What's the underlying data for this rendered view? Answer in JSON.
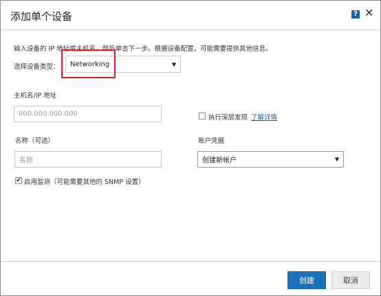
{
  "dialog": {
    "title": "添加单个设备",
    "help_icon": "?",
    "close_icon": "✕"
  },
  "intro": "输入设备的 IP 地址或主机名，然后单击下一步。根据设备配置，可能需要提供其他信息。",
  "device_type": {
    "label": "选择设备类型：",
    "value": "Networking"
  },
  "hostname": {
    "label": "主机名/IP 地址",
    "placeholder": "000.000.000.000"
  },
  "deep_discovery": {
    "label": "执行深层发现",
    "link": "了解详情",
    "checked": false
  },
  "name_field": {
    "label": "名称（可选）",
    "placeholder": "名称"
  },
  "credentials": {
    "label": "账户凭据",
    "value": "创建新帐户"
  },
  "monitoring": {
    "label": "启用监测（可能需要其他的 SNMP 设置）",
    "checked": true,
    "check_glyph": "✔"
  },
  "buttons": {
    "create": "创建",
    "cancel": "取消"
  },
  "colors": {
    "primary": "#1a73b8",
    "highlight": "#e02020",
    "link": "#1a5f9e"
  }
}
